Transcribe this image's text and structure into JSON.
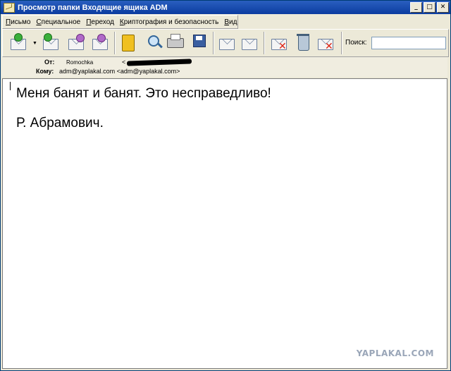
{
  "window": {
    "title": "Просмотр папки Входящие ящика ADM",
    "minimize": "_",
    "maximize": "□",
    "close": "✕"
  },
  "menu": {
    "items": [
      {
        "accel": "П",
        "rest": "исьмо"
      },
      {
        "accel": "С",
        "rest": "пециальное"
      },
      {
        "accel": "П",
        "rest": "ереход"
      },
      {
        "accel": "К",
        "rest": "риптография и безопасность"
      },
      {
        "accel": "В",
        "rest": "ид"
      }
    ]
  },
  "toolbar": {
    "icons": [
      "receive-mail-icon",
      "reply-all-icon",
      "forward-icon",
      "forward-as-icon",
      "address-book-icon",
      "find-icon",
      "print-icon",
      "save-icon",
      "move-up-icon",
      "move-down-icon",
      "delete-icon",
      "trash-icon",
      "delete-spam-icon"
    ],
    "search_label": "Поиск:",
    "search_value": ""
  },
  "headers": {
    "from_label": "От:",
    "from_name": "Romochka",
    "from_bracket": "<",
    "to_label": "Кому:",
    "to_value": "adm@yaplakal.com <adm@yaplakal.com>"
  },
  "message": {
    "line1": "Меня банят и банят. Это несправедливо!",
    "line2": "Р. Абрамович."
  },
  "watermark": "YAPLAKAL.COM"
}
